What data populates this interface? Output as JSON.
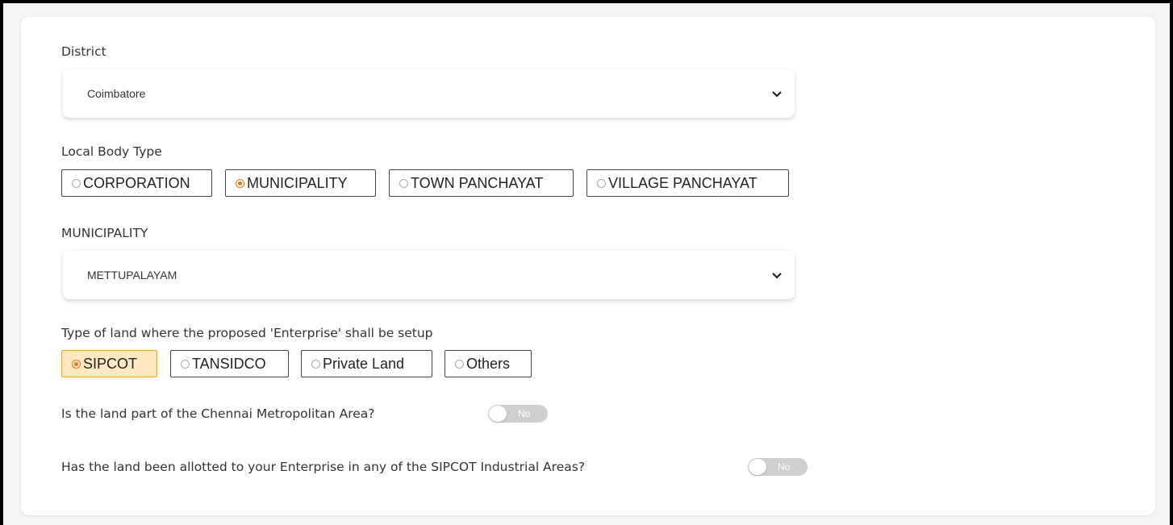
{
  "district": {
    "label": "District",
    "selected": "Coimbatore"
  },
  "local_body_type": {
    "label": "Local Body Type",
    "options": [
      "CORPORATION",
      "MUNICIPALITY",
      "TOWN PANCHAYAT",
      "VILLAGE PANCHAYAT"
    ],
    "selected": "MUNICIPALITY"
  },
  "municipality": {
    "label": "MUNICIPALITY",
    "selected": "METTUPALAYAM"
  },
  "land_type": {
    "label": "Type of land where the proposed 'Enterprise' shall be setup",
    "options": [
      "SIPCOT",
      "TANSIDCO",
      "Private Land",
      "Others"
    ],
    "selected": "SIPCOT"
  },
  "chennai_metro": {
    "question": "Is the land part of the Chennai Metropolitan Area?",
    "toggle_text": "No"
  },
  "sipcot_allotted": {
    "question": "Has the land been allotted to your Enterprise in any of the SIPCOT Industrial Areas?",
    "toggle_text": "No"
  },
  "colors": {
    "accent": "#e8741c",
    "selected_bg": "#fde8c2",
    "toggle_off": "#cfcfcf"
  },
  "icons": {
    "select_chevron": "chevron-down-icon"
  }
}
